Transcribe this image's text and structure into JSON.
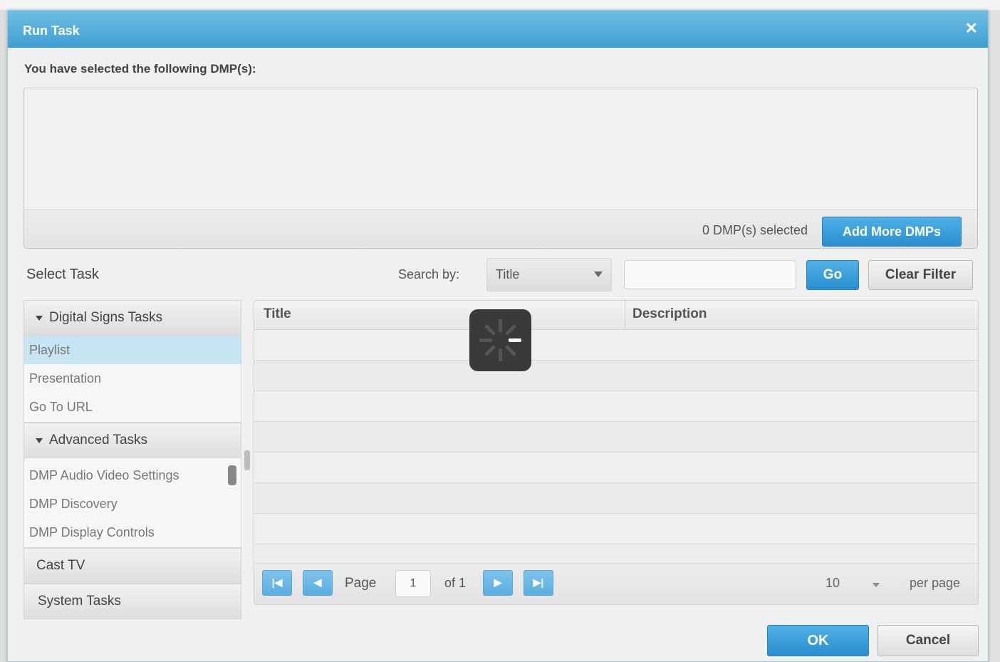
{
  "dialog": {
    "title": "Run Task",
    "close_icon": "close-icon",
    "selected_label": "You have selected the following DMP(s):",
    "dmp_count_text": "0 DMP(s) selected",
    "add_more_label": "Add More DMPs"
  },
  "select_task_label": "Select Task",
  "search": {
    "label": "Search by:",
    "field": "Title",
    "input_value": "",
    "go_label": "Go",
    "clear_label": "Clear Filter"
  },
  "task_groups": [
    {
      "label": "Digital Signs Tasks",
      "expanded": true,
      "items": [
        "Playlist",
        "Presentation",
        "Go To URL"
      ],
      "selected": "Playlist"
    },
    {
      "label": "Advanced Tasks",
      "expanded": true,
      "items": [
        "DMP Audio Video Settings",
        "DMP Discovery",
        "DMP Display Controls"
      ]
    },
    {
      "label": "Cast TV",
      "expanded": false
    },
    {
      "label": "System Tasks",
      "expanded": false
    }
  ],
  "grid": {
    "columns": [
      "Title",
      "Description"
    ],
    "rows": []
  },
  "pager": {
    "page_label": "Page",
    "page_value": "1",
    "of_label": "of 1",
    "per_page_value": "10",
    "per_page_label": "per page",
    "icons": [
      "first-page-icon",
      "prev-page-icon",
      "next-page-icon",
      "last-page-icon"
    ]
  },
  "footer": {
    "ok_label": "OK",
    "cancel_label": "Cancel"
  },
  "colors": {
    "titlebar": "#4aa8d9",
    "primary_button": "#2a8ed0",
    "selected_item": "#c7e4f3"
  }
}
